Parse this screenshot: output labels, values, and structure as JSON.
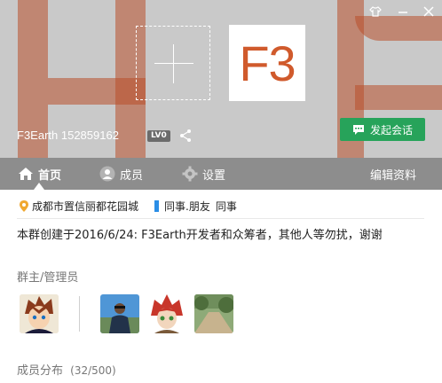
{
  "header": {
    "group_name": "F3Earth 152859162",
    "level": "LV0",
    "logo_text": "F3",
    "chat_button": "发起会话"
  },
  "tabs": [
    {
      "label": "首页",
      "icon": "home-icon",
      "active": true
    },
    {
      "label": "成员",
      "icon": "user-icon",
      "active": false
    },
    {
      "label": "设置",
      "icon": "gear-icon",
      "active": false
    },
    {
      "label": "编辑资料",
      "icon": "",
      "active": false
    }
  ],
  "info": {
    "location": "成都市置信丽都花园城",
    "tags": [
      "同事.朋友",
      "同事"
    ],
    "description": "本群创建于2016/6/24: F3Earth开发者和众筹者，其他人等勿扰，谢谢"
  },
  "admins": {
    "title": "群主/管理员",
    "avatars": [
      "owner-avatar",
      "admin-avatar-1",
      "admin-avatar-2",
      "admin-avatar-3"
    ]
  },
  "members": {
    "title": "成员分布",
    "count": "(32/500)"
  },
  "colors": {
    "accent_green": "#27a35a",
    "tab_bar": "#8d8d8d",
    "logo_orange": "#d05a2c",
    "tag_blue": "#2b8ee6"
  }
}
